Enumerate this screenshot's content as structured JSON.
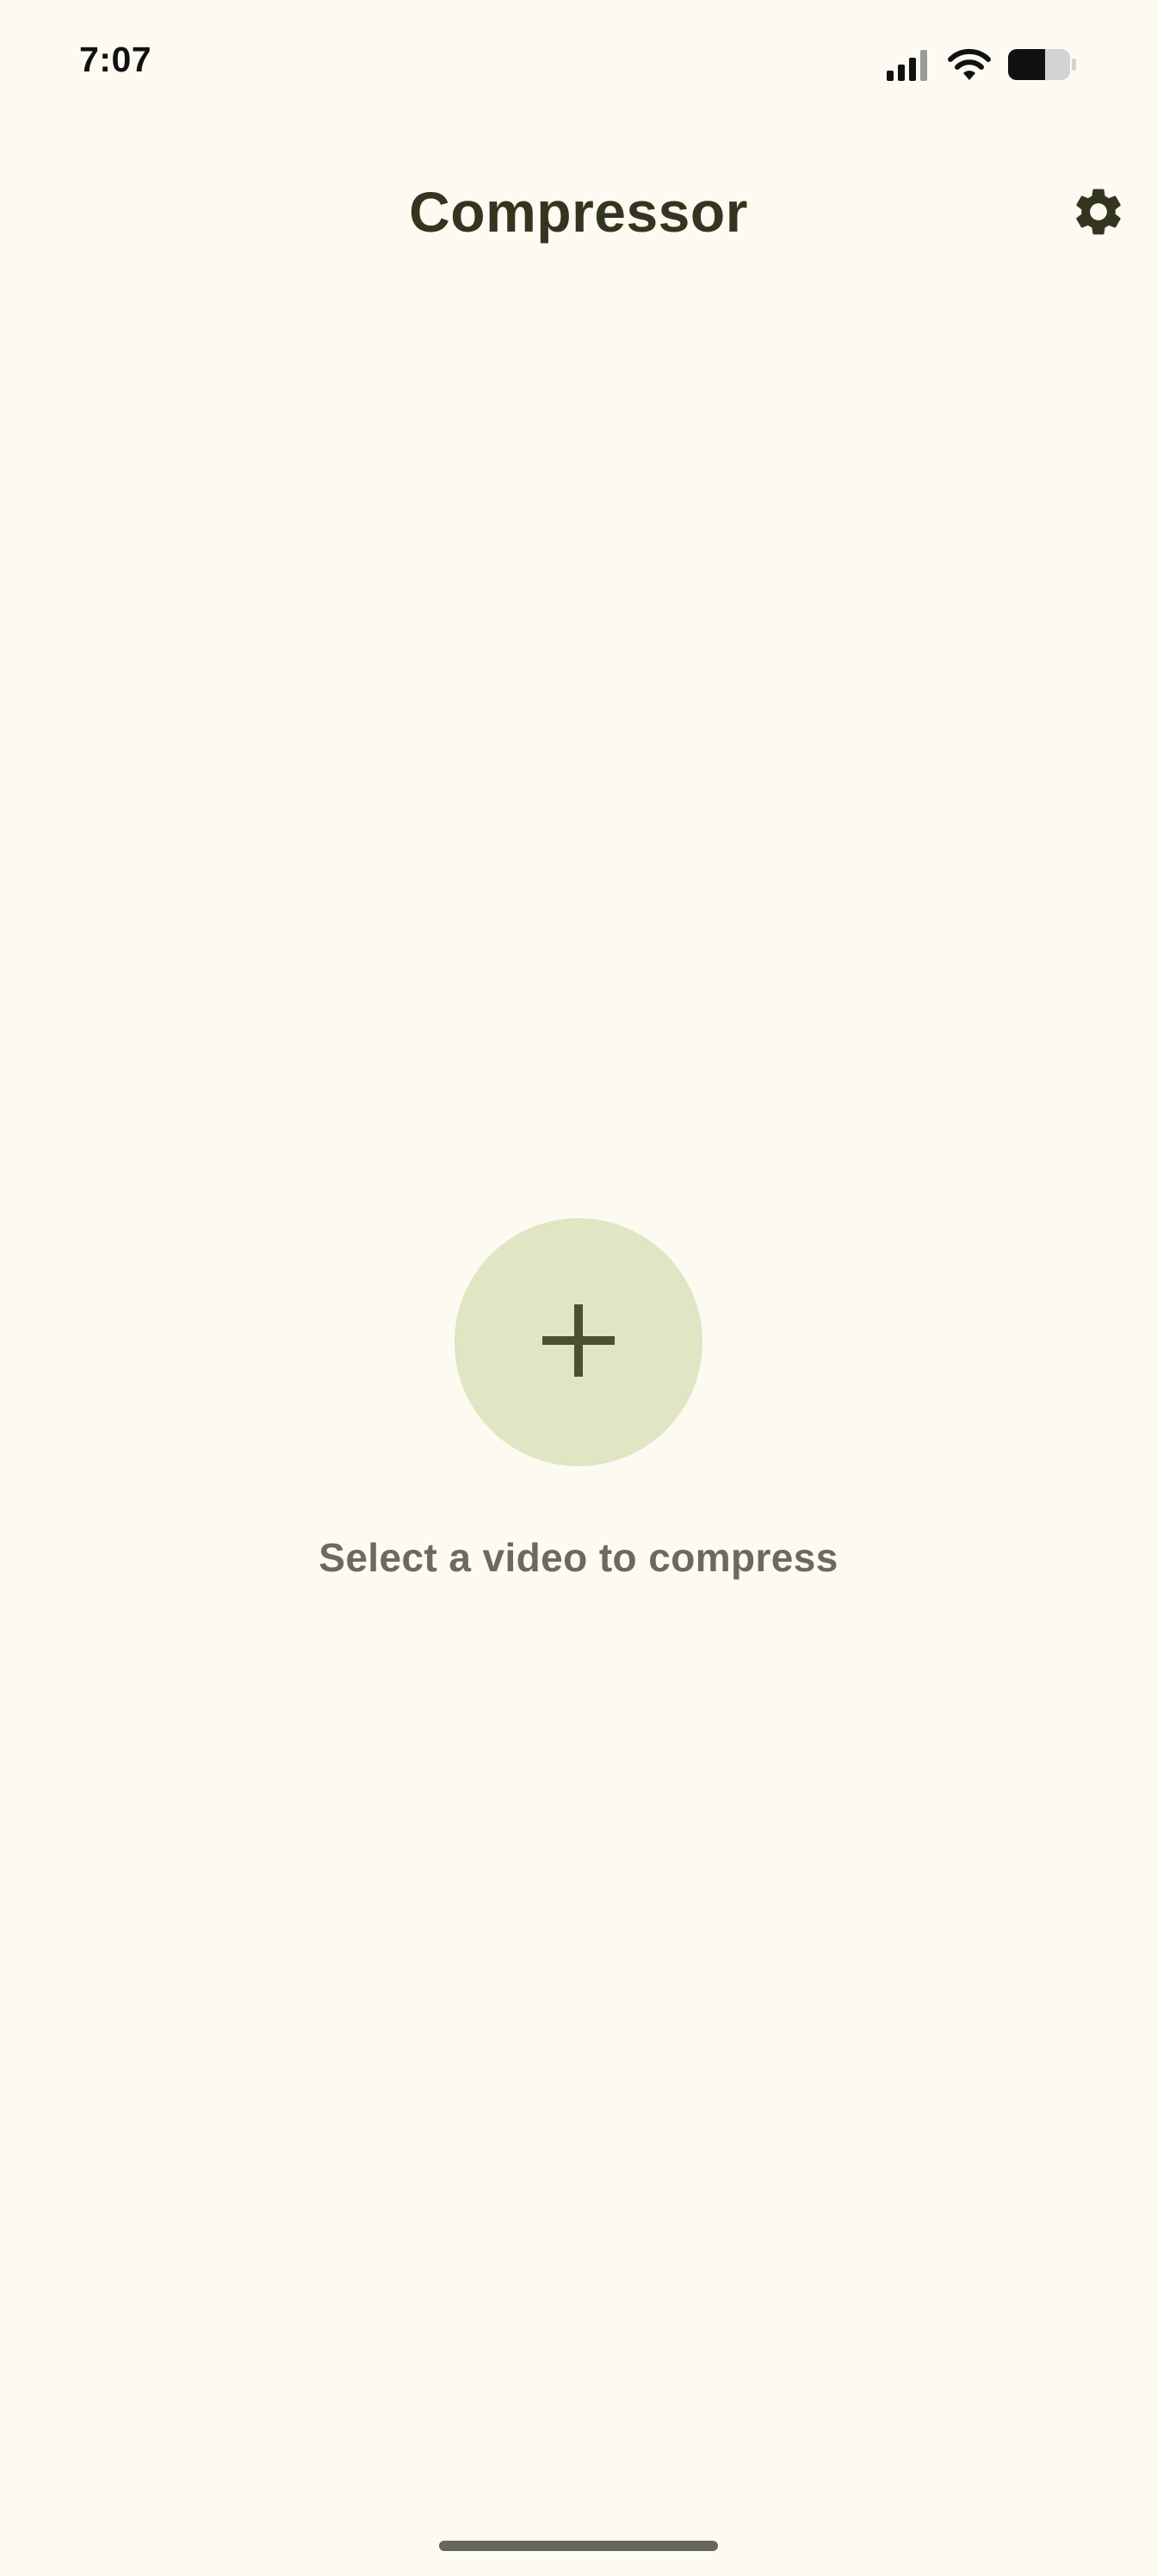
{
  "status_bar": {
    "time": "7:07",
    "icons": [
      "signal-icon",
      "wifi-icon",
      "battery-icon"
    ]
  },
  "app_bar": {
    "title": "Compressor",
    "settings_icon": "gear-icon"
  },
  "empty_state": {
    "add_icon": "plus-icon",
    "label": "Select a video to compress"
  },
  "colors": {
    "background": "#fcfaf1",
    "title_text": "#33351f",
    "add_button_fill": "#e0e5c3",
    "plus_stroke": "#4d5030",
    "label_text": "#6b6a5d",
    "home_indicator": "#666660"
  }
}
